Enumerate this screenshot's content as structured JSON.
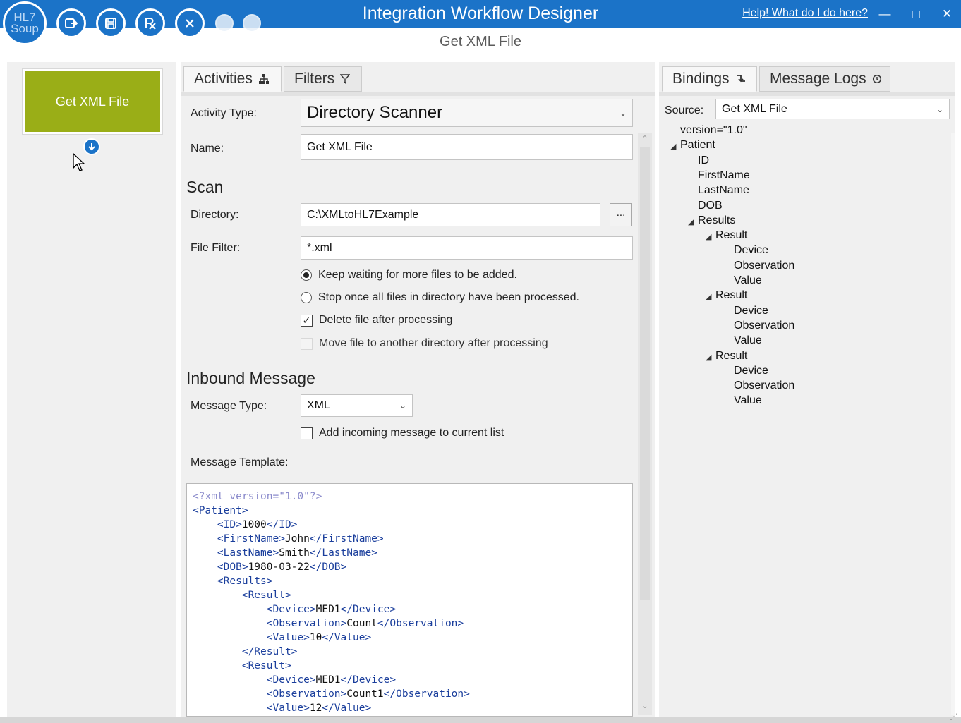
{
  "app": {
    "logo_text": "HL7 Soup",
    "title": "Integration Workflow Designer",
    "help_link": "Help!  What do I do here?",
    "subtitle": "Get XML File",
    "window_controls": [
      "minimize",
      "maximize",
      "close"
    ]
  },
  "toolbar": {
    "buttons": [
      {
        "name": "export-icon"
      },
      {
        "name": "save-icon"
      },
      {
        "name": "run-icon"
      },
      {
        "name": "close-circle-icon"
      },
      {
        "name": "disabled-action-icon"
      },
      {
        "name": "disabled-action-icon"
      }
    ]
  },
  "workflow": {
    "node_label": "Get XML File",
    "node_color": "#9aae17"
  },
  "tabs": {
    "activities": "Activities",
    "filters": "Filters",
    "bindings": "Bindings",
    "message_logs": "Message Logs"
  },
  "form": {
    "activity_type_label": "Activity Type:",
    "activity_type_value": "Directory Scanner",
    "name_label": "Name:",
    "name_value": "Get XML File",
    "scan_heading": "Scan",
    "directory_label": "Directory:",
    "directory_value": "C:\\XMLtoHL7Example",
    "browse_label": "...",
    "file_filter_label": "File Filter:",
    "file_filter_value": "*.xml",
    "radio_keep_waiting": "Keep waiting for more files to be added.",
    "radio_stop": "Stop once all files in directory have been processed.",
    "check_delete": "Delete file after processing",
    "check_move": "Move file to another directory after processing",
    "inbound_heading": "Inbound Message",
    "message_type_label": "Message Type:",
    "message_type_value": "XML",
    "check_add_incoming": "Add incoming message to current list",
    "message_template_label": "Message Template:"
  },
  "template_lines": [
    {
      "indent": 0,
      "decl": "<?xml version=\"1.0\"?>"
    },
    {
      "indent": 0,
      "open": "<Patient>"
    },
    {
      "indent": 1,
      "open": "<ID>",
      "text": "1000",
      "close": "</ID>"
    },
    {
      "indent": 1,
      "open": "<FirstName>",
      "text": "John",
      "close": "</FirstName>"
    },
    {
      "indent": 1,
      "open": "<LastName>",
      "text": "Smith",
      "close": "</LastName>"
    },
    {
      "indent": 1,
      "open": "<DOB>",
      "text": "1980-03-22",
      "close": "</DOB>"
    },
    {
      "indent": 1,
      "open": "<Results>"
    },
    {
      "indent": 2,
      "open": "<Result>"
    },
    {
      "indent": 3,
      "open": "<Device>",
      "text": "MED1",
      "close": "</Device>"
    },
    {
      "indent": 3,
      "open": "<Observation>",
      "text": "Count",
      "close": "</Observation>"
    },
    {
      "indent": 3,
      "open": "<Value>",
      "text": "10",
      "close": "</Value>"
    },
    {
      "indent": 2,
      "open": "</Result>"
    },
    {
      "indent": 2,
      "open": "<Result>"
    },
    {
      "indent": 3,
      "open": "<Device>",
      "text": "MED1",
      "close": "</Device>"
    },
    {
      "indent": 3,
      "open": "<Observation>",
      "text": "Count1",
      "close": "</Observation>"
    },
    {
      "indent": 3,
      "open": "<Value>",
      "text": "12",
      "close": "</Value>"
    }
  ],
  "bindings": {
    "source_label": "Source:",
    "source_value": "Get XML File",
    "tree": [
      {
        "label": "version=\"1.0\"",
        "level": 0,
        "expandable": false
      },
      {
        "label": "Patient",
        "level": 0,
        "expandable": true
      },
      {
        "label": "ID",
        "level": 1,
        "expandable": false
      },
      {
        "label": "FirstName",
        "level": 1,
        "expandable": false
      },
      {
        "label": "LastName",
        "level": 1,
        "expandable": false
      },
      {
        "label": "DOB",
        "level": 1,
        "expandable": false
      },
      {
        "label": "Results",
        "level": 1,
        "expandable": true
      },
      {
        "label": "Result",
        "level": 2,
        "expandable": true
      },
      {
        "label": "Device",
        "level": 3,
        "expandable": false
      },
      {
        "label": "Observation",
        "level": 3,
        "expandable": false
      },
      {
        "label": "Value",
        "level": 3,
        "expandable": false
      },
      {
        "label": "Result",
        "level": 2,
        "expandable": true
      },
      {
        "label": "Device",
        "level": 3,
        "expandable": false
      },
      {
        "label": "Observation",
        "level": 3,
        "expandable": false
      },
      {
        "label": "Value",
        "level": 3,
        "expandable": false
      },
      {
        "label": "Result",
        "level": 2,
        "expandable": true
      },
      {
        "label": "Device",
        "level": 3,
        "expandable": false
      },
      {
        "label": "Observation",
        "level": 3,
        "expandable": false
      },
      {
        "label": "Value",
        "level": 3,
        "expandable": false
      }
    ]
  },
  "colors": {
    "titlebar": "#1b73c8",
    "pane_bg": "#f0f0f0",
    "xml_tag": "#1a3e9c",
    "xml_decl": "#8a8acb"
  }
}
